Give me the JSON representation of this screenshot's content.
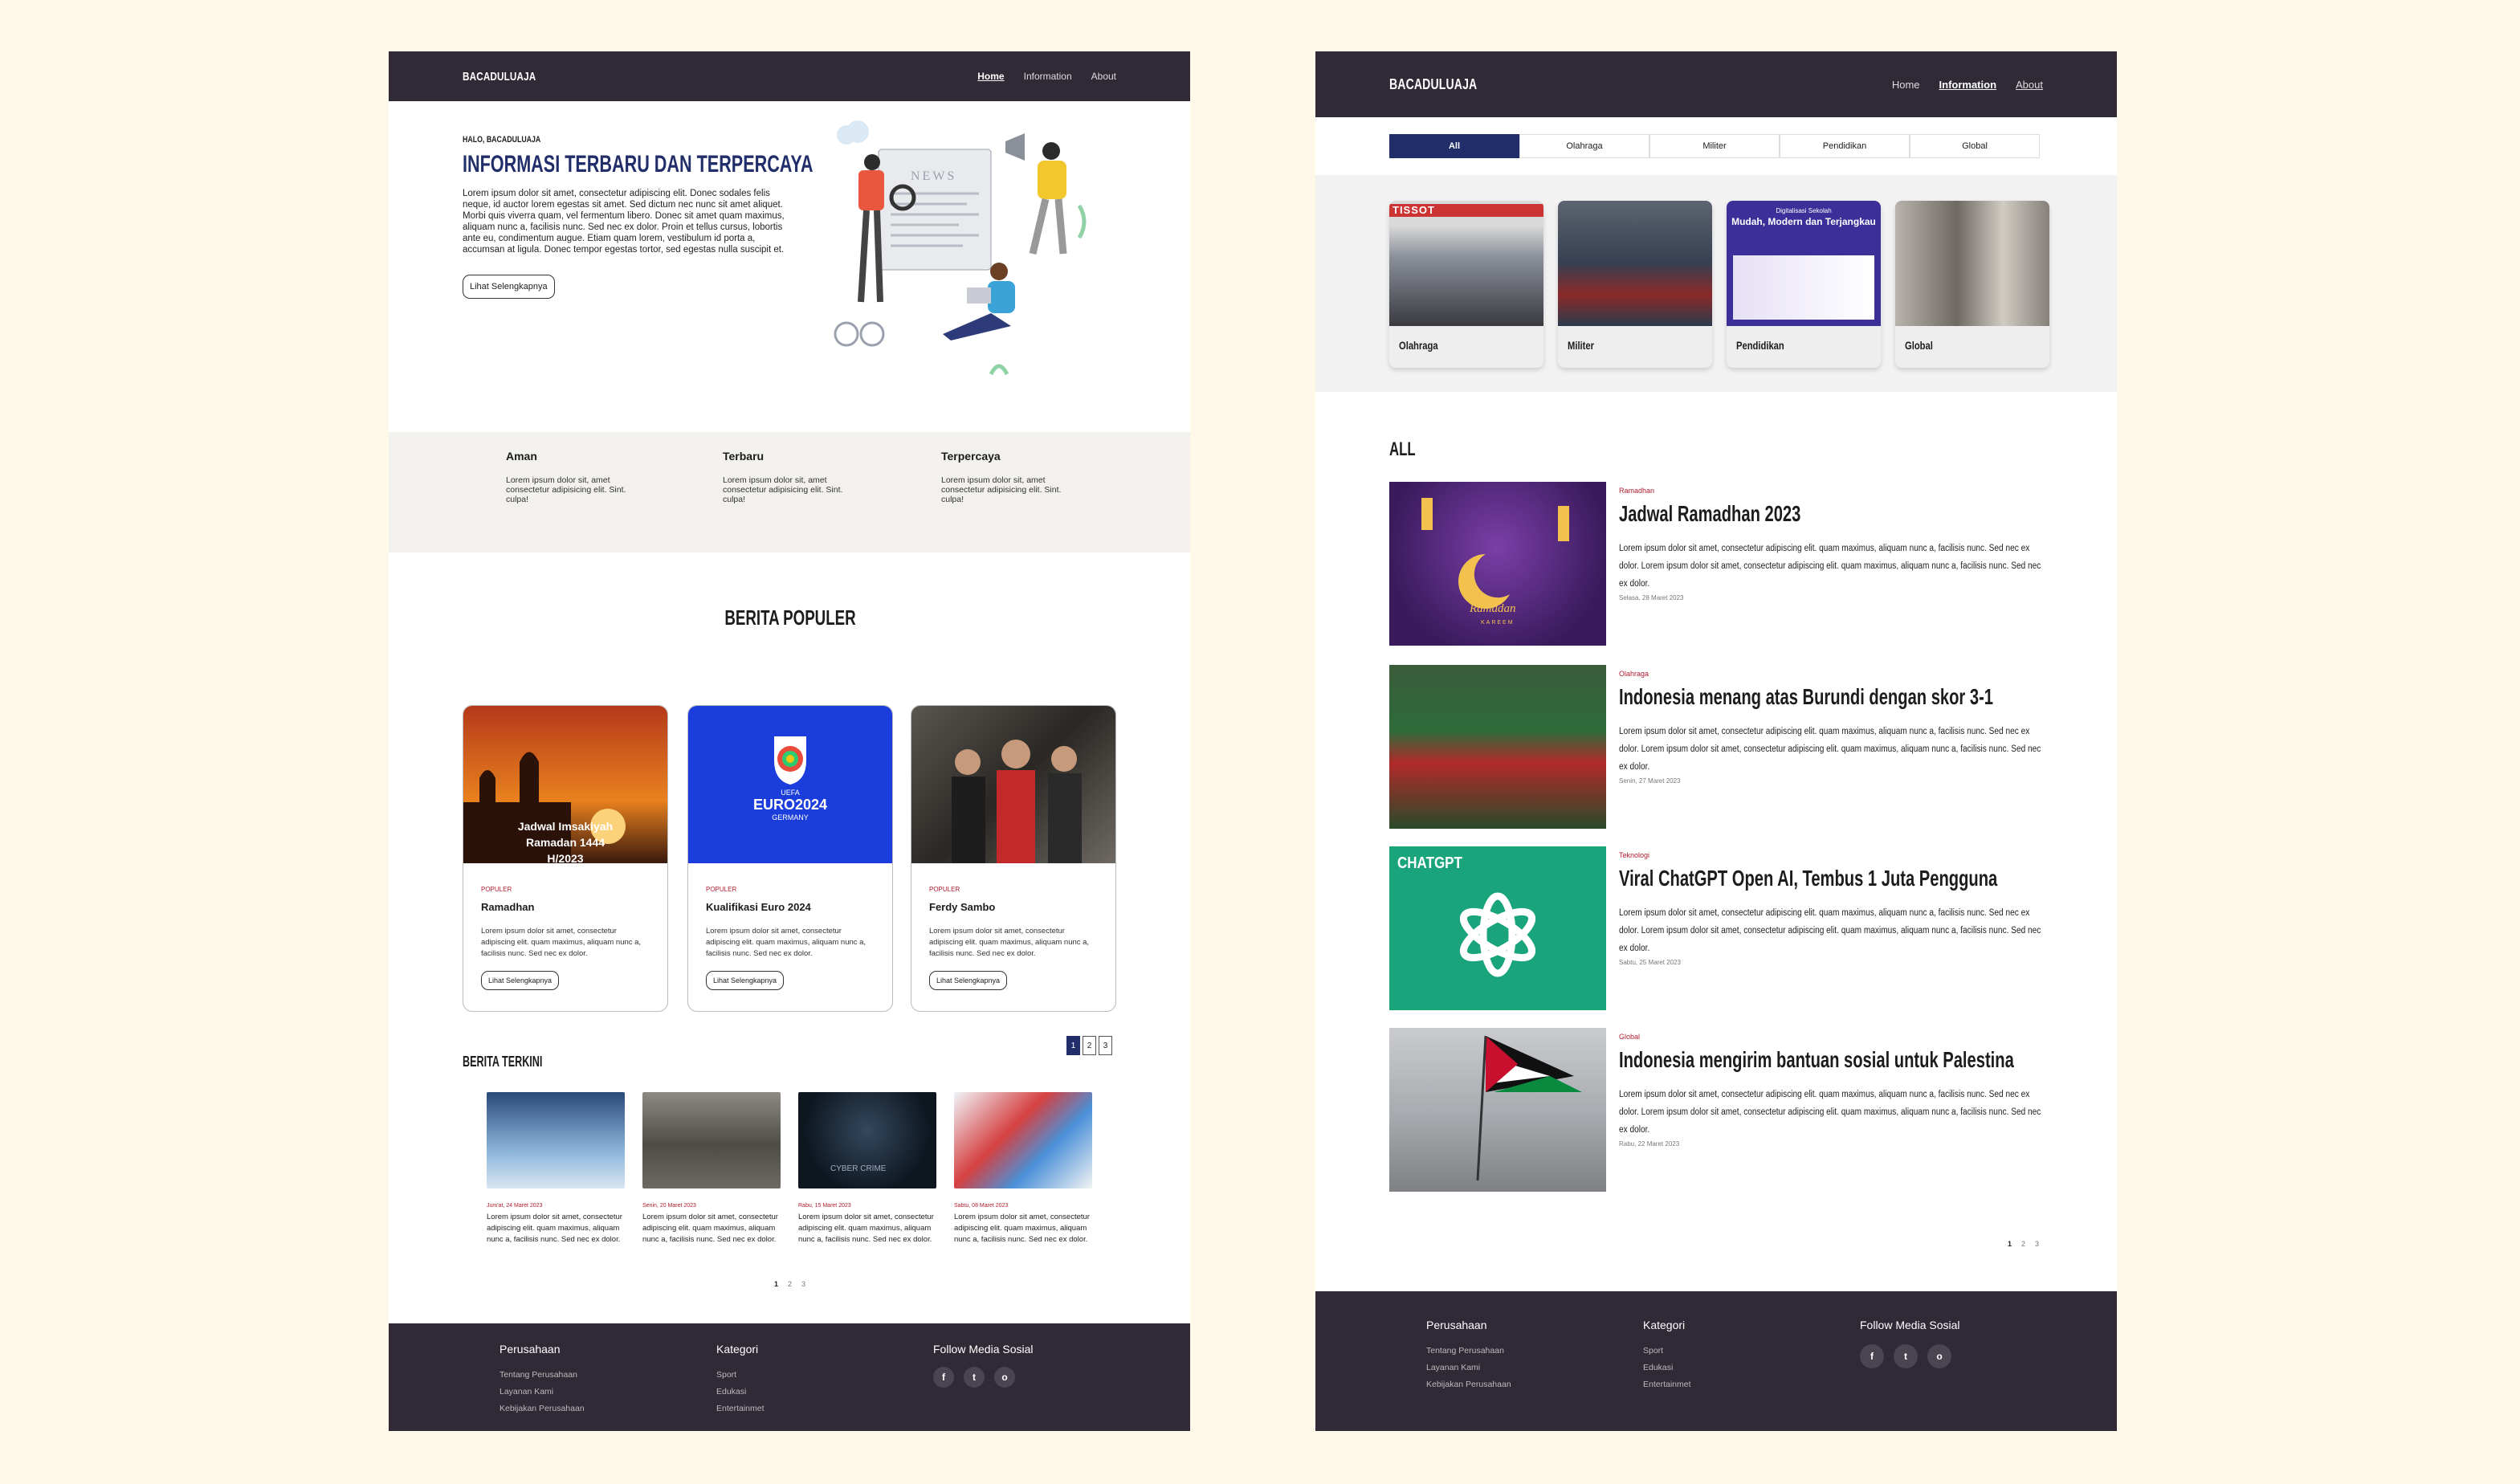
{
  "left": {
    "brand": "BACADULUAJA",
    "nav": [
      "Home",
      "Information",
      "About"
    ],
    "hero": {
      "hello": "HALO, BACADULUAJA",
      "title": "INFORMASI TERBARU DAN TERPERCAYA",
      "body": "Lorem ipsum dolor sit amet, consectetur adipiscing elit. Donec sodales felis neque, id auctor lorem egestas sit amet. Sed dictum nec nunc sit amet aliquet. Morbi quis viverra quam, vel fermentum libero. Donec sit amet quam maximus, aliquam nunc a, facilisis nunc. Sed nec ex dolor. Proin et tellus cursus, lobortis ante eu, condimentum augue. Etiam quam lorem, vestibulum id porta a, accumsan at ligula. Donec tempor egestas tortor, sed egestas nulla suscipit et.",
      "button": "Lihat Selengkapnya",
      "news_sign": "NEWS"
    },
    "features": [
      {
        "title": "Aman",
        "text": "Lorem ipsum dolor sit, amet consectetur adipisicing elit. Sint. culpa!"
      },
      {
        "title": "Terbaru",
        "text": "Lorem ipsum dolor sit, amet consectetur adipisicing elit. Sint. culpa!"
      },
      {
        "title": "Terpercaya",
        "text": "Lorem ipsum dolor sit, amet consectetur adipisicing elit. Sint. culpa!"
      }
    ],
    "populer_title": "BERITA POPULER",
    "popular": [
      {
        "tag": "POPULER",
        "title": "Ramadhan",
        "text": "Lorem ipsum dolor sit amet, consectetur adipiscing elit. quam maximus, aliquam nunc a, facilisis nunc. Sed nec ex dolor.",
        "button": "Lihat Selengkapnya",
        "overlay": "Jadwal Imsakiyah Ramadan 1444 H/2023"
      },
      {
        "tag": "POPULER",
        "title": "Kualifikasi Euro 2024",
        "text": "Lorem ipsum dolor sit amet, consectetur adipiscing elit. quam maximus, aliquam nunc a, facilisis nunc. Sed nec ex dolor.",
        "button": "Lihat Selengkapnya",
        "overlay": "EURO2024",
        "overlay_sub": "GERMANY",
        "overlay_top": "UEFA"
      },
      {
        "tag": "POPULER",
        "title": "Ferdy Sambo",
        "text": "Lorem ipsum dolor sit amet, consectetur adipiscing elit. quam maximus, aliquam nunc a, facilisis nunc. Sed nec ex dolor.",
        "button": "Lihat Selengkapnya"
      }
    ],
    "populer_pages": [
      "1",
      "2",
      "3"
    ],
    "terkini_title": "BERITA TERKINI",
    "latest": [
      {
        "date": "Jum'at, 24 Maret 2023",
        "text": "Lorem ipsum dolor sit amet, consectetur adipiscing elit. quam maximus, aliquam nunc a, facilisis nunc. Sed nec ex dolor."
      },
      {
        "date": "Senin, 20 Maret 2023",
        "text": "Lorem ipsum dolor sit amet, consectetur adipiscing elit. quam maximus, aliquam nunc a, facilisis nunc. Sed nec ex dolor."
      },
      {
        "date": "Rabu, 15 Maret 2023",
        "text": "Lorem ipsum dolor sit amet, consectetur adipiscing elit. quam maximus, aliquam nunc a, facilisis nunc. Sed nec ex dolor.",
        "overlay": "CYBER CRIME"
      },
      {
        "date": "Sabtu, 08 Maret 2023",
        "text": "Lorem ipsum dolor sit amet, consectetur adipiscing elit. quam maximus, aliquam nunc a, facilisis nunc. Sed nec ex dolor."
      }
    ],
    "terkini_pages": [
      "1",
      "2",
      "3"
    ]
  },
  "footer": {
    "col1_title": "Perusahaan",
    "col1": [
      "Tentang Perusahaan",
      "Layanan Kami",
      "Kebijakan Perusahaan"
    ],
    "col2_title": "Kategori",
    "col2": [
      "Sport",
      "Edukasi",
      "Entertainmet"
    ],
    "col3_title": "Follow Media Sosial",
    "social": [
      "f",
      "t",
      "o"
    ]
  },
  "right": {
    "brand": "BACADULUAJA",
    "nav": [
      "Home",
      "Information",
      "About"
    ],
    "filters": [
      "All",
      "Olahraga",
      "Militer",
      "Pendidikan",
      "Global"
    ],
    "categories": [
      "Olahraga",
      "Militer",
      "Pendidikan",
      "Global"
    ],
    "cat_overlay": {
      "tissot": "TISSOT",
      "edu_top": "Digitalisasi Sekolah",
      "edu_title": "Mudah, Modern dan Terjangkau"
    },
    "list_title": "ALL",
    "news": [
      {
        "tag": "Ramadhan",
        "title": "Jadwal Ramadhan 2023",
        "text": "Lorem ipsum dolor sit amet, consectetur adipiscing elit. quam maximus, aliquam nunc a, facilisis nunc. Sed nec ex dolor. Lorem ipsum dolor sit amet, consectetur adipiscing elit. quam maximus, aliquam nunc a, facilisis nunc. Sed nec ex dolor.",
        "date": "Selasa, 28 Maret 2023",
        "overlay": "Ramadan",
        "overlay_sub": "KAREEM"
      },
      {
        "tag": "Olahraga",
        "title": "Indonesia menang atas Burundi dengan skor 3-1",
        "text": "Lorem ipsum dolor sit amet, consectetur adipiscing elit. quam maximus, aliquam nunc a, facilisis nunc. Sed nec ex dolor. Lorem ipsum dolor sit amet, consectetur adipiscing elit. quam maximus, aliquam nunc a, facilisis nunc. Sed nec ex dolor.",
        "date": "Senin, 27 Maret 2023"
      },
      {
        "tag": "Teknologi",
        "title": "Viral ChatGPT Open AI, Tembus 1 Juta Pengguna",
        "text": "Lorem ipsum dolor sit amet, consectetur adipiscing elit. quam maximus, aliquam nunc a, facilisis nunc. Sed nec ex dolor. Lorem ipsum dolor sit amet, consectetur adipiscing elit. quam maximus, aliquam nunc a, facilisis nunc. Sed nec ex dolor.",
        "date": "Sabtu, 25 Maret 2023",
        "overlay": "CHATGPT"
      },
      {
        "tag": "Global",
        "title": "Indonesia mengirim bantuan sosial untuk Palestina",
        "text": "Lorem ipsum dolor sit amet, consectetur adipiscing elit. quam maximus, aliquam nunc a, facilisis nunc. Sed nec ex dolor. Lorem ipsum dolor sit amet, consectetur adipiscing elit. quam maximus, aliquam nunc a, facilisis nunc. Sed nec ex dolor.",
        "date": "Rabu, 22 Maret 2023"
      }
    ],
    "pages": [
      "1",
      "2",
      "3"
    ]
  },
  "colors": {
    "nav_bg": "#2f2a35",
    "accent": "#222e6a",
    "tag_red": "#b01c2e",
    "page_bg": "#fdf8e8"
  }
}
